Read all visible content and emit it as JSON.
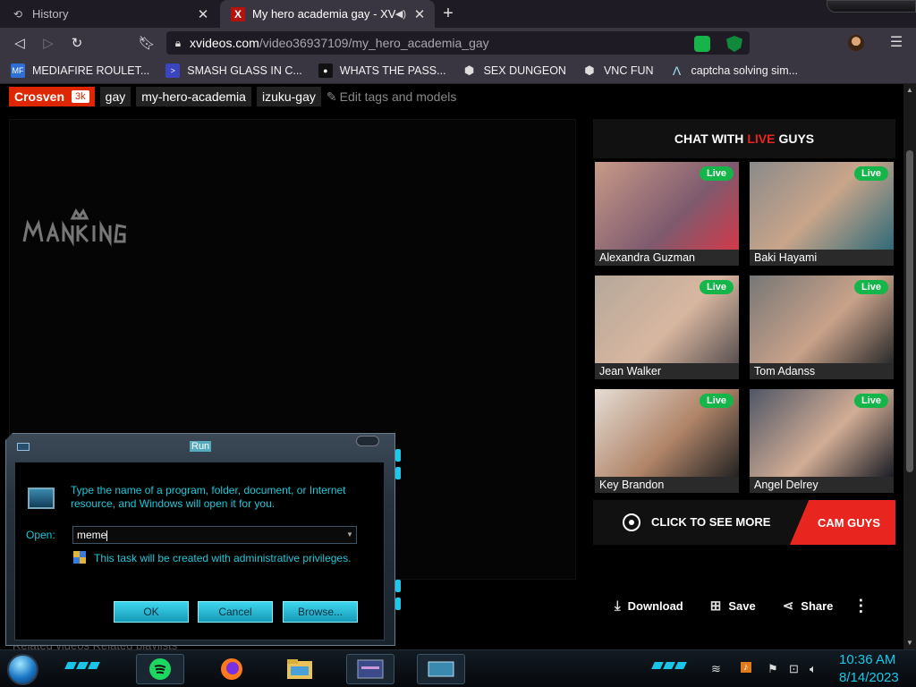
{
  "browser": {
    "tabs": [
      {
        "title": "History",
        "icon": "history-icon"
      },
      {
        "title": "My hero academia gay - XVID",
        "icon": "xvideos-favicon"
      }
    ],
    "url": {
      "domain": "xvideos.com",
      "path": "/video36937109/my_hero_academia_gay"
    },
    "bookmarks": [
      {
        "label": "MEDIAFIRE ROULET...",
        "badge": "MF"
      },
      {
        "label": "SMASH GLASS IN C..."
      },
      {
        "label": "WHATS THE PASS..."
      },
      {
        "label": "SEX DUNGEON"
      },
      {
        "label": "VNC FUN"
      },
      {
        "label": "captcha solving sim..."
      }
    ]
  },
  "page": {
    "uploader": {
      "name": "Crosven",
      "count": "3k"
    },
    "tags": [
      "gay",
      "my-hero-academia",
      "izuku-gay"
    ],
    "edit_tags": "Edit tags and models",
    "chat": {
      "prefix": "CHAT WITH",
      "live": "LIVE",
      "suffix": "GUYS"
    },
    "live_label": "Live",
    "cams": [
      {
        "name": "Alexandra Guzman",
        "color": "#b8746a"
      },
      {
        "name": "Baki Hayami",
        "color": "#6f8b8e"
      },
      {
        "name": "Jean Walker",
        "color": "#a08878"
      },
      {
        "name": "Tom Adanss",
        "color": "#5e5a58"
      },
      {
        "name": "Key Brandon",
        "color": "#b8a290"
      },
      {
        "name": "Angel Delrey",
        "color": "#6a6e78"
      }
    ],
    "see_more": "CLICK TO SEE MORE",
    "cam_guys": "CAM GUYS",
    "actions": {
      "download": "Download",
      "save": "Save",
      "share": "Share"
    },
    "related": "Related videos    Related playlists"
  },
  "run_dialog": {
    "title": "Run",
    "description": "Type the name of a program, folder, document, or Internet resource, and Windows will open it for you.",
    "open_label": "Open:",
    "input_value": "meme",
    "admin_note": "This task will be created with administrative privileges.",
    "buttons": {
      "ok": "OK",
      "cancel": "Cancel",
      "browse": "Browse..."
    }
  },
  "taskbar": {
    "time": "10:36 AM",
    "date": "8/14/2023"
  },
  "colors": {
    "accent_red": "#e8261f",
    "live_green": "#14b549",
    "cyan": "#1fc7d8"
  }
}
